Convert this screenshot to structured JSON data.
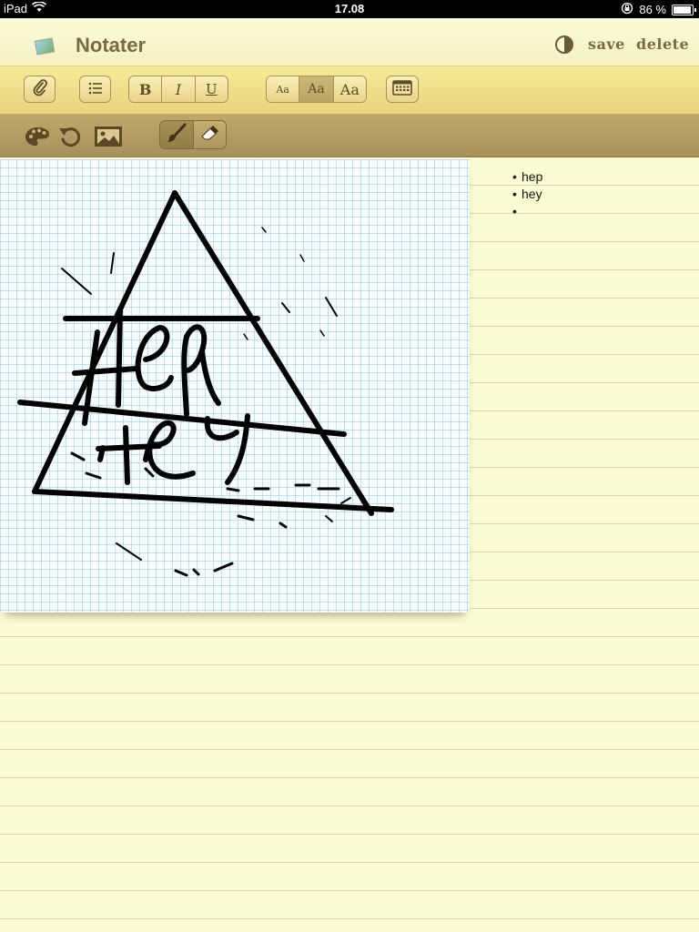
{
  "status_bar": {
    "device": "iPad",
    "time": "17.08",
    "battery": "86 %",
    "battery_level": 0.86
  },
  "app": {
    "title": "Notater",
    "save_label": "save",
    "delete_label": "delete"
  },
  "format_toolbar": {
    "bold": "B",
    "italic": "I",
    "underline": "U",
    "text_sizes": [
      "Aa",
      "Aa",
      "Aa"
    ],
    "active_size_index": 1
  },
  "drawing_toolbar": {
    "active_tool": "brush"
  },
  "note": {
    "bullets": [
      "hep",
      "hey",
      ""
    ],
    "bullet_char": "•"
  },
  "colors": {
    "paper": "#fbfbd4",
    "toolbar": "#f7eb98",
    "drawing_toolbar": "#bfa86c",
    "accent_text": "#7a6a42"
  }
}
